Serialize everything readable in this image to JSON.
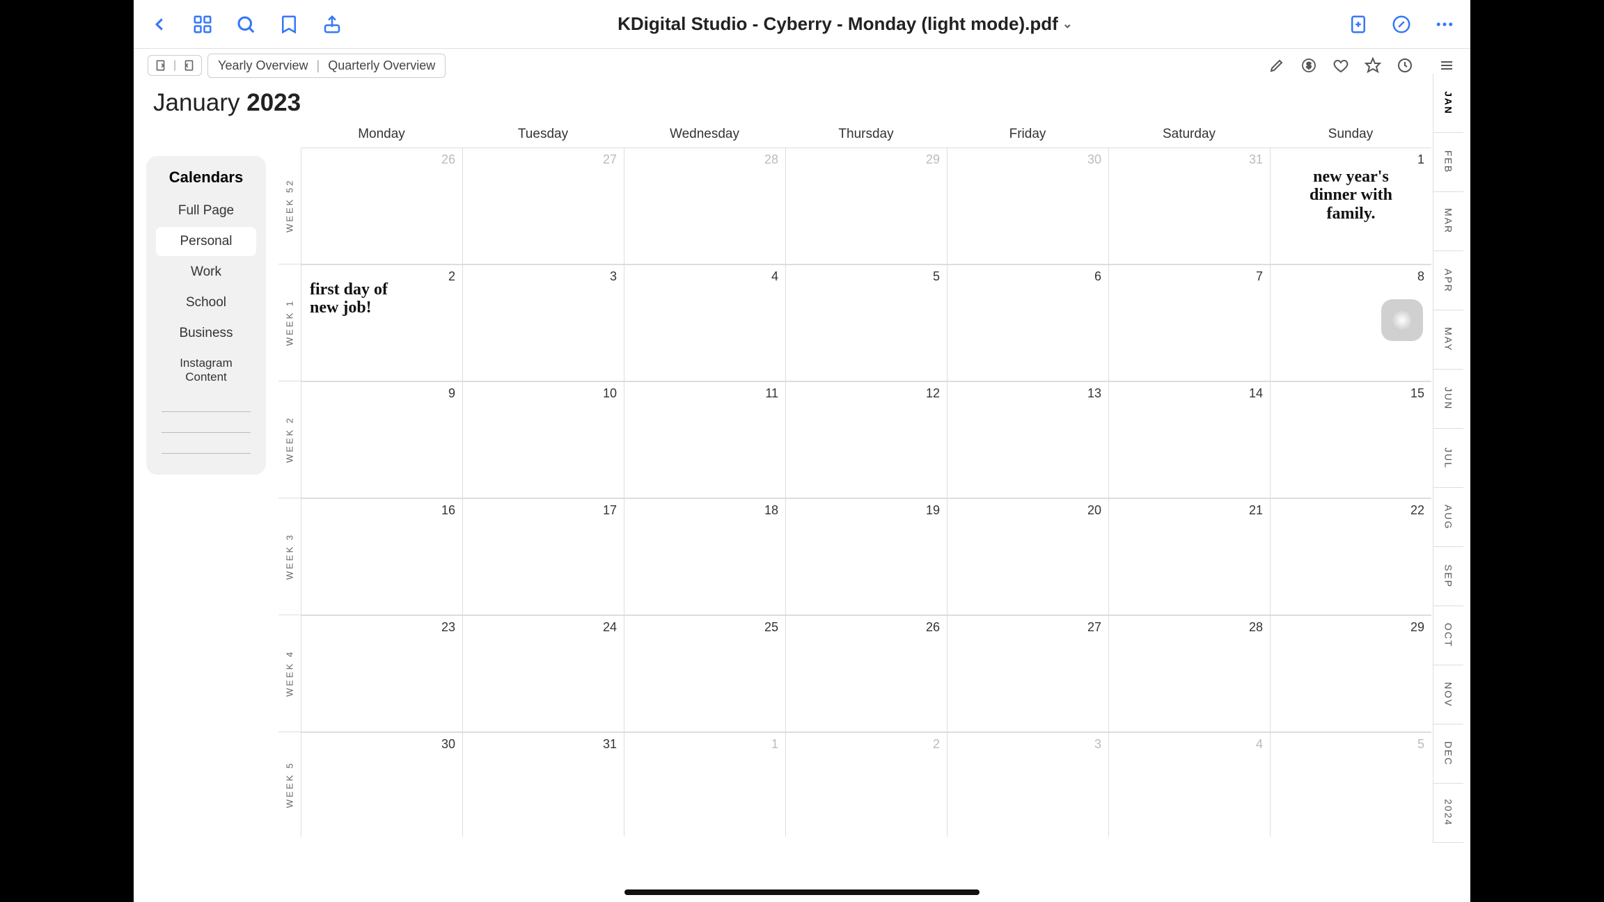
{
  "toolbar": {
    "title": "KDigital Studio - Cyberry - Monday (light mode).pdf"
  },
  "overview": {
    "yearly": "Yearly Overview",
    "quarterly": "Quarterly Overview"
  },
  "month_label": "January ",
  "year_label": "2023",
  "sidebar": {
    "title": "Calendars",
    "items": [
      "Full Page",
      "Personal",
      "Work",
      "School",
      "Business",
      "Instagram Content"
    ],
    "active_index": 1
  },
  "day_names": [
    "Monday",
    "Tuesday",
    "Wednesday",
    "Thursday",
    "Friday",
    "Saturday",
    "Sunday"
  ],
  "weeks": [
    {
      "label": "WEEK 52",
      "days": [
        {
          "n": "26",
          "dim": true
        },
        {
          "n": "27",
          "dim": true
        },
        {
          "n": "28",
          "dim": true
        },
        {
          "n": "29",
          "dim": true
        },
        {
          "n": "30",
          "dim": true
        },
        {
          "n": "31",
          "dim": true
        },
        {
          "n": "1",
          "note": "new year's\ndinner with\nfamily.",
          "center": true
        }
      ]
    },
    {
      "label": "WEEK 1",
      "days": [
        {
          "n": "2",
          "note": "first day of\nnew job!"
        },
        {
          "n": "3"
        },
        {
          "n": "4"
        },
        {
          "n": "5"
        },
        {
          "n": "6"
        },
        {
          "n": "7"
        },
        {
          "n": "8"
        }
      ]
    },
    {
      "label": "WEEK 2",
      "days": [
        {
          "n": "9"
        },
        {
          "n": "10"
        },
        {
          "n": "11"
        },
        {
          "n": "12"
        },
        {
          "n": "13"
        },
        {
          "n": "14"
        },
        {
          "n": "15"
        }
      ]
    },
    {
      "label": "WEEK 3",
      "days": [
        {
          "n": "16"
        },
        {
          "n": "17"
        },
        {
          "n": "18"
        },
        {
          "n": "19"
        },
        {
          "n": "20"
        },
        {
          "n": "21"
        },
        {
          "n": "22"
        }
      ]
    },
    {
      "label": "WEEK 4",
      "days": [
        {
          "n": "23"
        },
        {
          "n": "24"
        },
        {
          "n": "25"
        },
        {
          "n": "26"
        },
        {
          "n": "27"
        },
        {
          "n": "28"
        },
        {
          "n": "29"
        }
      ]
    },
    {
      "label": "WEEK 5",
      "days": [
        {
          "n": "30"
        },
        {
          "n": "31"
        },
        {
          "n": "1",
          "dim": true
        },
        {
          "n": "2",
          "dim": true
        },
        {
          "n": "3",
          "dim": true
        },
        {
          "n": "4",
          "dim": true
        },
        {
          "n": "5",
          "dim": true
        }
      ]
    }
  ],
  "month_tabs": [
    "JAN",
    "FEB",
    "MAR",
    "APR",
    "MAY",
    "JUN",
    "JUL",
    "AUG",
    "SEP",
    "OCT",
    "NOV",
    "DEC",
    "2024"
  ],
  "active_month_tab": 0
}
